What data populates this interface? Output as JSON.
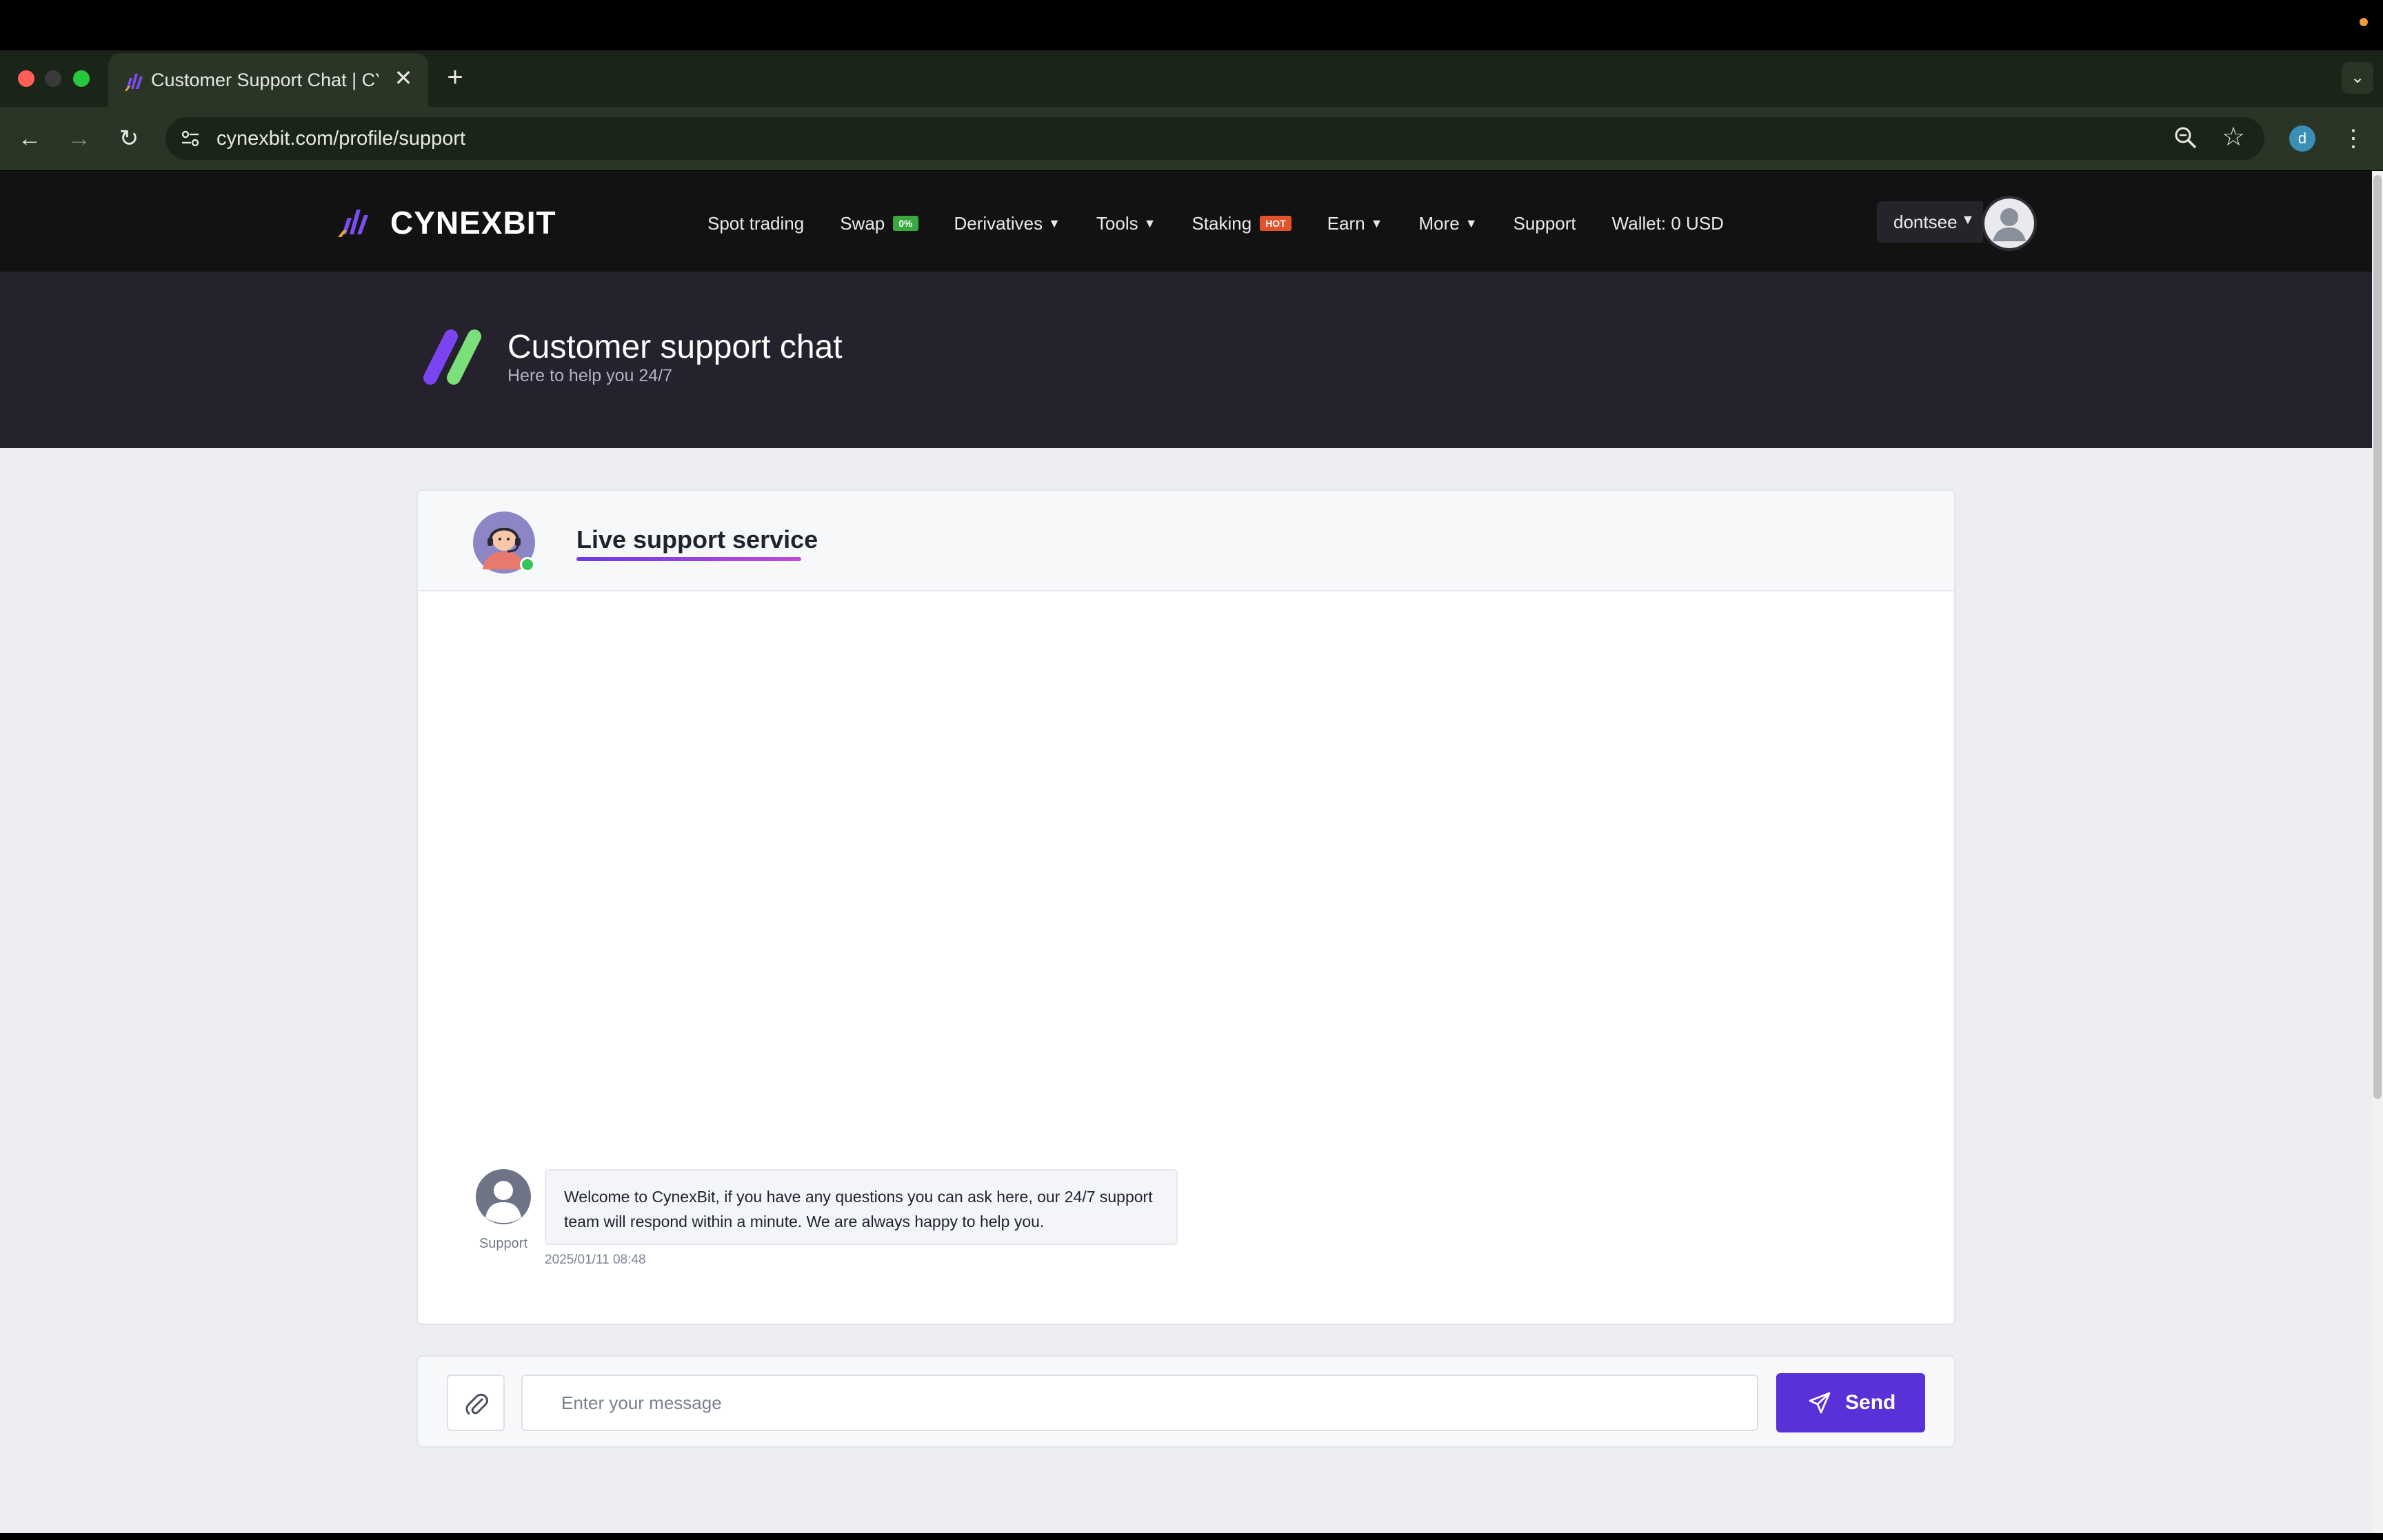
{
  "browser": {
    "tab_title": "Customer Support Chat | CYNEXBIT",
    "url": "cynexbit.com/profile/support",
    "profile_initial": "d"
  },
  "site": {
    "brand": "CYNEXBIT",
    "nav": [
      {
        "label": "Spot trading"
      },
      {
        "label": "Swap",
        "badge": "0%"
      },
      {
        "label": "Derivatives",
        "dropdown": true
      },
      {
        "label": "Tools",
        "dropdown": true
      },
      {
        "label": "Staking",
        "badge": "HOT"
      },
      {
        "label": "Earn",
        "dropdown": true
      },
      {
        "label": "More",
        "dropdown": true
      },
      {
        "label": "Support"
      },
      {
        "label": "Wallet: 0 USD"
      }
    ],
    "user": {
      "name": "dontsee"
    }
  },
  "hero": {
    "title": "Customer support chat",
    "subtitle": "Here to help you 24/7"
  },
  "chat": {
    "title": "Live support service",
    "messages": [
      {
        "sender": "Support",
        "text": "Welcome to CynexBit, if you have any questions you can ask here, our 24/7 support team will respond within a minute. We are always happy to help you.",
        "time": "2025/01/11 08:48"
      }
    ]
  },
  "composer": {
    "placeholder": "Enter your message",
    "send_label": "Send"
  },
  "colors": {
    "accent": "#5a30d8",
    "nav_bg": "#121213",
    "hero_bg": "#25222e",
    "badge_swap": "#3aa841",
    "badge_hot": "#e3532b",
    "online": "#33c45a"
  }
}
